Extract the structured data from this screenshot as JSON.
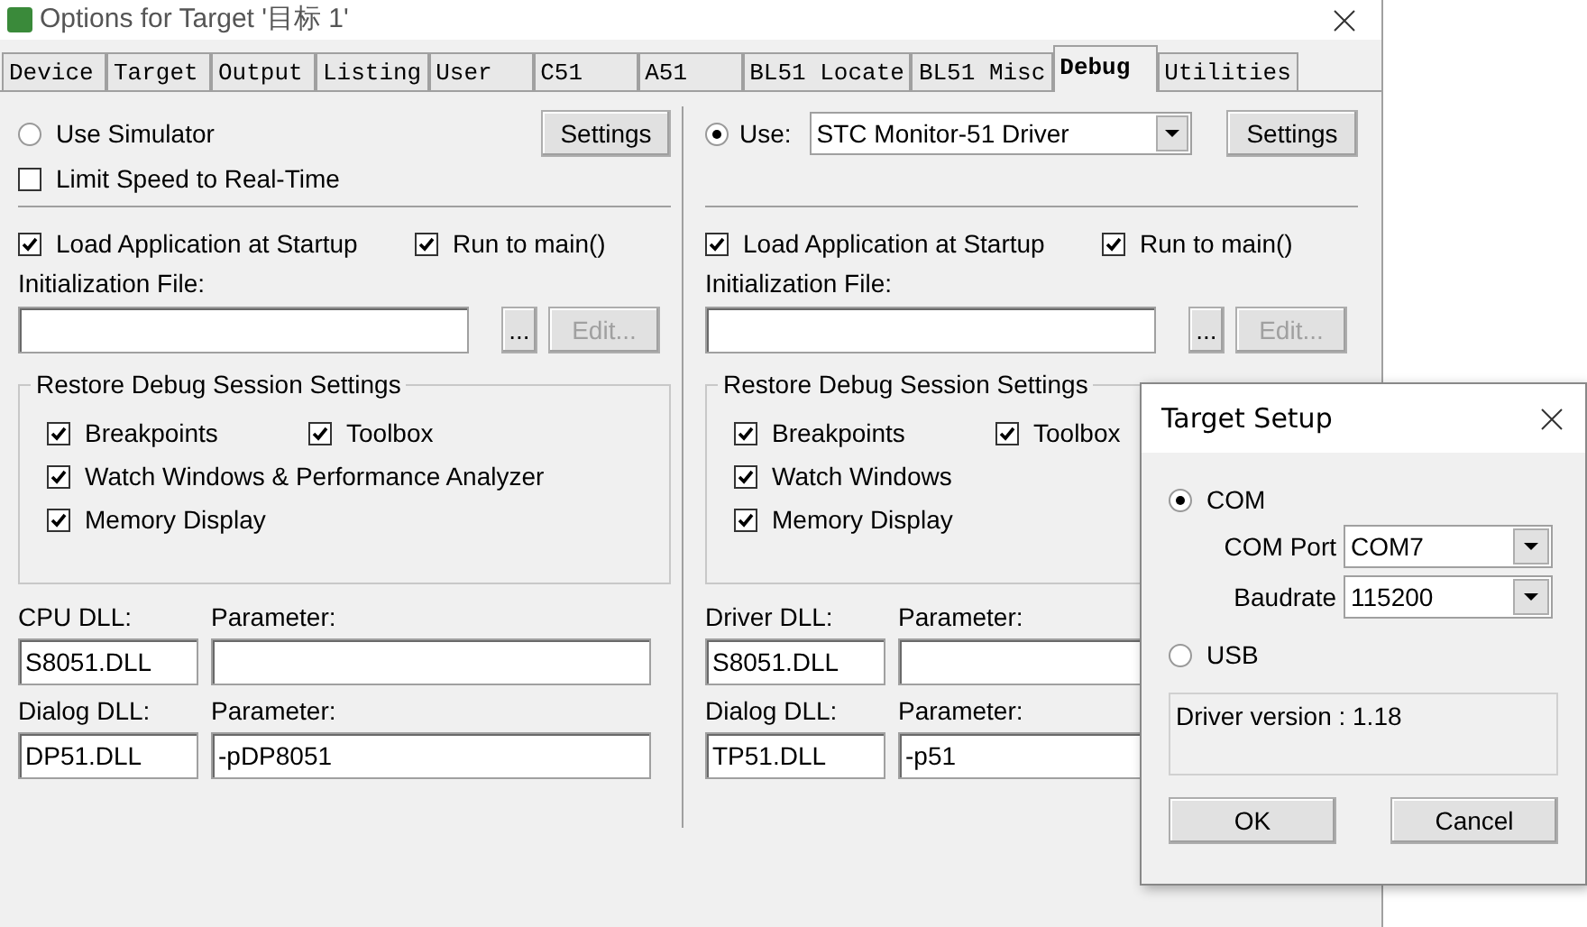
{
  "window": {
    "title": "Options for Target '目标 1'"
  },
  "tabs": [
    {
      "label": "Device",
      "selected": false
    },
    {
      "label": "Target",
      "selected": false
    },
    {
      "label": "Output",
      "selected": false
    },
    {
      "label": "Listing",
      "selected": false
    },
    {
      "label": "User",
      "selected": false
    },
    {
      "label": "C51",
      "selected": false
    },
    {
      "label": "A51",
      "selected": false
    },
    {
      "label": "BL51 Locate",
      "selected": false
    },
    {
      "label": "BL51 Misc",
      "selected": false
    },
    {
      "label": "Debug",
      "selected": true
    },
    {
      "label": "Utilities",
      "selected": false
    }
  ],
  "left": {
    "mode": {
      "label": "Use Simulator",
      "selected": false
    },
    "settings_button": "Settings",
    "limit_speed": {
      "label": "Limit Speed to Real-Time",
      "checked": false
    },
    "load_app": {
      "label": "Load Application at Startup",
      "checked": true
    },
    "run_to_main": {
      "label": "Run to main()",
      "checked": true
    },
    "init_file_label": "Initialization File:",
    "browse_button": "...",
    "edit_button": {
      "label": "Edit...",
      "disabled": true
    },
    "restore_group": {
      "title": "Restore Debug Session Settings",
      "options": [
        {
          "label": "Breakpoints",
          "checked": true
        },
        {
          "label": "Toolbox",
          "checked": true
        },
        {
          "label": "Watch Windows & Performance Analyzer",
          "checked": true
        },
        {
          "label": "Memory Display",
          "checked": true
        }
      ]
    },
    "dll_rows": [
      {
        "label": "CPU DLL:",
        "value": "S8051.DLL",
        "param_label": "Parameter:"
      },
      {
        "label": "Dialog DLL:",
        "value": "DP51.DLL",
        "param_label": "Parameter:",
        "param_value": "-pDP8051"
      }
    ]
  },
  "right": {
    "mode": {
      "label": "Use:",
      "selected": true
    },
    "driver": "STC Monitor-51 Driver",
    "settings_button": "Settings",
    "load_app": {
      "label": "Load Application at Startup",
      "checked": true
    },
    "run_to_main": {
      "label": "Run to main()",
      "checked": true
    },
    "init_file_label": "Initialization File:",
    "browse_button": "...",
    "edit_button": {
      "label": "Edit...",
      "disabled": true
    },
    "restore_group": {
      "title": "Restore Debug Session Settings",
      "options": [
        {
          "label": "Breakpoints",
          "checked": true
        },
        {
          "label": "Toolbox",
          "checked": true
        },
        {
          "label": "Watch Windows",
          "checked": true
        },
        {
          "label": "Memory Display",
          "checked": true
        }
      ]
    },
    "dll_rows": [
      {
        "label": "Driver DLL:",
        "value": "S8051.DLL",
        "param_label": "Parameter:"
      },
      {
        "label": "Dialog DLL:",
        "value": "TP51.DLL",
        "param_label": "Parameter:",
        "param_value": "-p51"
      }
    ]
  },
  "target_setup": {
    "title": "Target Setup",
    "ports": [
      {
        "label": "COM",
        "selected": true
      },
      {
        "label": "USB",
        "selected": false
      }
    ],
    "com_port": {
      "label": "COM Port",
      "value": "COM7"
    },
    "baudrate": {
      "label": "Baudrate",
      "value": "115200"
    },
    "info": "Driver version : 1.18",
    "buttons": [
      "OK",
      "Cancel"
    ]
  }
}
